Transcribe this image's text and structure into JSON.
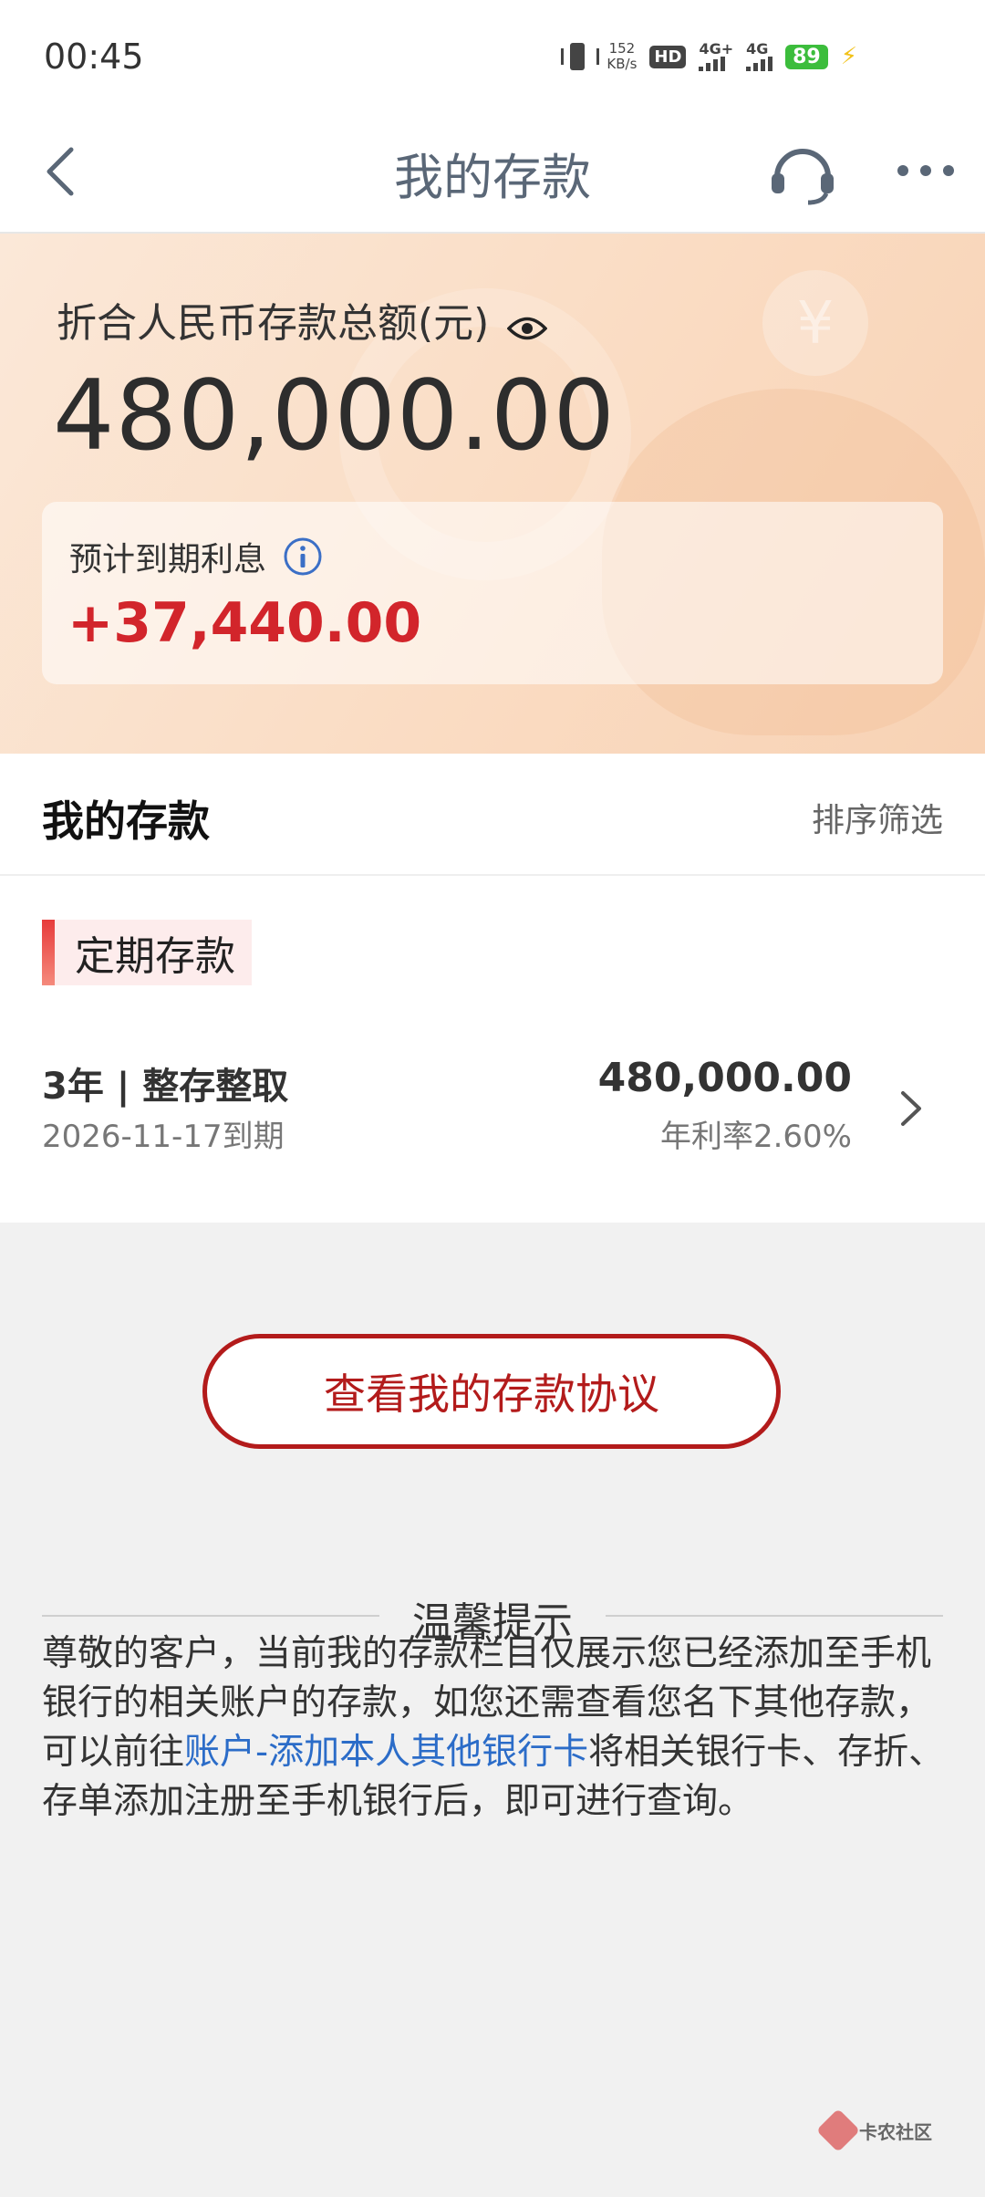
{
  "status_bar": {
    "time": "00:45",
    "speed_value": "152",
    "speed_unit": "KB/s",
    "hd_label": "HD",
    "net1_label": "4G+",
    "net2_label": "4G",
    "battery": "89"
  },
  "nav": {
    "title": "我的存款",
    "back_icon": "chevron-left-icon",
    "service_icon": "headset-icon",
    "more_icon": "more-icon"
  },
  "summary": {
    "label": "折合人民币存款总额(元)",
    "total": "480,000.00",
    "interest_label": "预计到期利息",
    "interest_value": "+37,440.00",
    "coin_symbol": "¥"
  },
  "deposits": {
    "section_title": "我的存款",
    "sort_filter": "排序筛选",
    "category": "定期存款",
    "items": [
      {
        "name": "3年 | 整存整取",
        "due": "2026-11-17到期",
        "amount": "480,000.00",
        "rate": "年利率2.60%"
      }
    ]
  },
  "agreement_button": "查看我的存款协议",
  "tips": {
    "title": "温馨提示",
    "text_before": "尊敬的客户，当前我的存款栏目仅展示您已经添加至手机银行的相关账户的存款，如您还需查看您名下其他存款，可以前往",
    "link": "账户-添加本人其他银行卡",
    "text_after": "将相关银行卡、存折、存单添加注册至手机银行后，即可进行查询。"
  },
  "colors": {
    "accent_red": "#b31b1b",
    "interest_red": "#d2252b",
    "link_blue": "#2b6cc8",
    "nav_title": "#5a6777"
  }
}
